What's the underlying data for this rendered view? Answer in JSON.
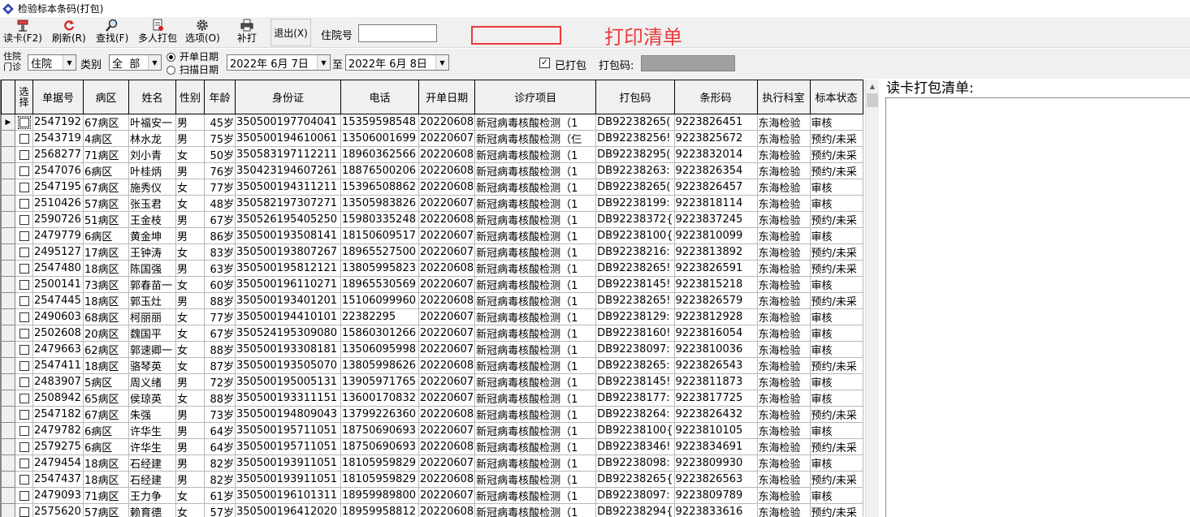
{
  "window": {
    "title": "检验标本条码(打包)"
  },
  "toolbar": {
    "read_card": "读卡(F2)",
    "refresh": "刷新(R)",
    "find": "查找(F)",
    "multi_pack": "多人打包",
    "options": "选项(O)",
    "reprint": "补打",
    "exit": "退出(X)",
    "inpatient_no_label": "住院号",
    "inpatient_no_value": "",
    "annotation": "打印清单"
  },
  "filters": {
    "vlabel_1": "住院",
    "vlabel_2": "门诊",
    "patient_type": "住院",
    "category_label": "类别",
    "category": "全  部",
    "radio_open_date": "开单日期",
    "radio_scan_date": "扫描日期",
    "date_from": "2022年 6月 7日",
    "to_label": "至",
    "date_to": "2022年 6月 8日",
    "packed_label": "已打包",
    "packed_checked": true,
    "pack_code_label": "打包码:"
  },
  "grid": {
    "columns": [
      "选择",
      "单据号",
      "病区",
      "姓名",
      "性别",
      "年龄",
      "身份证",
      "电话",
      "开单日期",
      "诊疗项目",
      "打包码",
      "条形码",
      "执行科室",
      "标本状态"
    ],
    "rows": [
      [
        "2547192",
        "67病区",
        "叶福安一",
        "男",
        "45岁",
        "350500197704041",
        "15359598548",
        "20220608",
        "新冠病毒核酸检测（1",
        "DB92238265(",
        "9223826451",
        "东海检验",
        "审核"
      ],
      [
        "2543719",
        "4病区",
        "林水龙",
        "男",
        "75岁",
        "350500194610061",
        "13506001699",
        "20220607",
        "新冠病毒核酸检测（仨",
        "DB92238256!",
        "9223825672",
        "东海检验",
        "预约/未采"
      ],
      [
        "2568277",
        "71病区",
        "刘小青",
        "女",
        "50岁",
        "350583197112211",
        "18960362566",
        "20220608",
        "新冠病毒核酸检测（1",
        "DB92238295(",
        "9223832014",
        "东海检验",
        "预约/未采"
      ],
      [
        "2547076",
        "6病区",
        "叶桂炳",
        "男",
        "76岁",
        "350423194607261",
        "18876500206",
        "20220608",
        "新冠病毒核酸检测（1",
        "DB92238263:",
        "9223826354",
        "东海检验",
        "预约/未采"
      ],
      [
        "2547195",
        "67病区",
        "施秀仪",
        "女",
        "77岁",
        "350500194311211",
        "15396508862",
        "20220608",
        "新冠病毒核酸检测（1",
        "DB92238265(",
        "9223826457",
        "东海检验",
        "审核"
      ],
      [
        "2510426",
        "57病区",
        "张玉君",
        "女",
        "48岁",
        "350582197307271",
        "13505983826",
        "20220607",
        "新冠病毒核酸检测（1",
        "DB92238199:",
        "9223818114",
        "东海检验",
        "审核"
      ],
      [
        "2590726",
        "51病区",
        "王金枝",
        "男",
        "67岁",
        "350526195405250",
        "15980335248",
        "20220608",
        "新冠病毒核酸检测（1",
        "DB92238372{",
        "9223837245",
        "东海检验",
        "预约/未采"
      ],
      [
        "2479779",
        "6病区",
        "黄金坤",
        "男",
        "86岁",
        "350500193508141",
        "18150609517",
        "20220607",
        "新冠病毒核酸检测（1",
        "DB92238100{",
        "9223810099",
        "东海检验",
        "审核"
      ],
      [
        "2495127",
        "17病区",
        "王钟涛",
        "女",
        "83岁",
        "350500193807267",
        "18965527500",
        "20220607",
        "新冠病毒核酸检测（1",
        "DB92238216:",
        "9223813892",
        "东海检验",
        "预约/未采"
      ],
      [
        "2547480",
        "18病区",
        "陈国强",
        "男",
        "63岁",
        "350500195812121",
        "13805995823",
        "20220608",
        "新冠病毒核酸检测（1",
        "DB92238265!",
        "9223826591",
        "东海检验",
        "预约/未采"
      ],
      [
        "2500141",
        "73病区",
        "郭春苗一",
        "女",
        "60岁",
        "350500196110271",
        "18965530569",
        "20220607",
        "新冠病毒核酸检测（1",
        "DB92238145!",
        "9223815218",
        "东海检验",
        "审核"
      ],
      [
        "2547445",
        "18病区",
        "郭玉灶",
        "男",
        "88岁",
        "350500193401201",
        "15106099960",
        "20220608",
        "新冠病毒核酸检测（1",
        "DB92238265!",
        "9223826579",
        "东海检验",
        "预约/未采"
      ],
      [
        "2490603",
        "68病区",
        "柯丽丽",
        "女",
        "77岁",
        "350500194410101",
        "22382295",
        "20220607",
        "新冠病毒核酸检测（1",
        "DB92238129:",
        "9223812928",
        "东海检验",
        "审核"
      ],
      [
        "2502608",
        "20病区",
        "魏国平",
        "女",
        "67岁",
        "350524195309080",
        "15860301266",
        "20220607",
        "新冠病毒核酸检测（1",
        "DB92238160!",
        "9223816054",
        "东海检验",
        "审核"
      ],
      [
        "2479663",
        "62病区",
        "郭速卿一",
        "女",
        "88岁",
        "350500193308181",
        "13506095998",
        "20220607",
        "新冠病毒核酸检测（1",
        "DB92238097:",
        "9223810036",
        "东海检验",
        "审核"
      ],
      [
        "2547411",
        "18病区",
        "骆琴英",
        "女",
        "87岁",
        "350500193505070",
        "13805998626",
        "20220608",
        "新冠病毒核酸检测（1",
        "DB92238265:",
        "9223826543",
        "东海检验",
        "预约/未采"
      ],
      [
        "2483907",
        "5病区",
        "周义绪",
        "男",
        "72岁",
        "350500195005131",
        "13905971765",
        "20220607",
        "新冠病毒核酸检测（1",
        "DB92238145!",
        "9223811873",
        "东海检验",
        "审核"
      ],
      [
        "2508942",
        "65病区",
        "侯琼英",
        "女",
        "88岁",
        "350500193311151",
        "13600170832",
        "20220607",
        "新冠病毒核酸检测（1",
        "DB92238177:",
        "9223817725",
        "东海检验",
        "审核"
      ],
      [
        "2547182",
        "67病区",
        "朱强",
        "男",
        "73岁",
        "350500194809043",
        "13799226360",
        "20220608",
        "新冠病毒核酸检测（1",
        "DB92238264:",
        "9223826432",
        "东海检验",
        "预约/未采"
      ],
      [
        "2479782",
        "6病区",
        "许华生",
        "男",
        "64岁",
        "350500195711051",
        "18750690693",
        "20220607",
        "新冠病毒核酸检测（1",
        "DB92238100{",
        "9223810105",
        "东海检验",
        "审核"
      ],
      [
        "2579275",
        "6病区",
        "许华生",
        "男",
        "64岁",
        "350500195711051",
        "18750690693",
        "20220608",
        "新冠病毒核酸检测（1",
        "DB92238346!",
        "9223834691",
        "东海检验",
        "预约/未采"
      ],
      [
        "2479454",
        "18病区",
        "石经建",
        "男",
        "82岁",
        "350500193911051",
        "18105959829",
        "20220607",
        "新冠病毒核酸检测（1",
        "DB92238098:",
        "9223809930",
        "东海检验",
        "审核"
      ],
      [
        "2547437",
        "18病区",
        "石经建",
        "男",
        "82岁",
        "350500193911051",
        "18105959829",
        "20220608",
        "新冠病毒核酸检测（1",
        "DB92238265{",
        "9223826563",
        "东海检验",
        "预约/未采"
      ],
      [
        "2479093",
        "71病区",
        "王力争",
        "女",
        "61岁",
        "350500196101311",
        "18959989800",
        "20220607",
        "新冠病毒核酸检测（1",
        "DB92238097:",
        "9223809789",
        "东海检验",
        "审核"
      ],
      [
        "2575620",
        "57病区",
        "赖育德",
        "女",
        "57岁",
        "350500196412020",
        "18959958812",
        "20220608",
        "新冠病毒核酸检测（1",
        "DB92238294{",
        "9223833616",
        "东海检验",
        "预约/未采"
      ]
    ]
  },
  "right_panel": {
    "title": "读卡打包清单:"
  }
}
